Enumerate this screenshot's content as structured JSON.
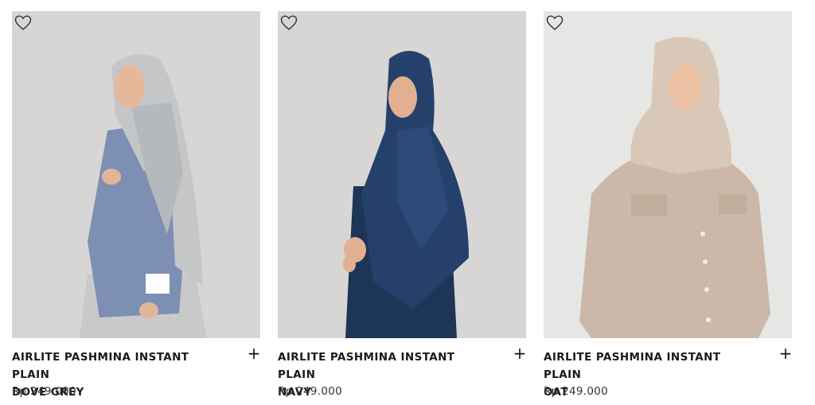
{
  "products": [
    {
      "title_line1": "AIRLITE PASHMINA INSTANT PLAIN",
      "title_line2": "DOVE GREY",
      "price": "Rp 249.000",
      "image_alt": "Model wearing Airlite Pashmina Instant Plain Dove Grey",
      "favorite_icon": "heart-outline-icon",
      "add_icon": "plus-icon",
      "add_symbol": "+",
      "colors": {
        "bg": "#d7d6d4",
        "scarf": "#c4c6c8",
        "garment": "#7d90b3"
      }
    },
    {
      "title_line1": "AIRLITE PASHMINA INSTANT PLAIN",
      "title_line2": "NAVY",
      "price": "Rp 249.000",
      "image_alt": "Model wearing Airlite Pashmina Instant Plain Navy",
      "favorite_icon": "heart-outline-icon",
      "add_icon": "plus-icon",
      "add_symbol": "+",
      "colors": {
        "bg": "#d7d6d4",
        "scarf": "#25406b",
        "garment": "#1d3556"
      }
    },
    {
      "title_line1": "AIRLITE PASHMINA INSTANT PLAIN",
      "title_line2": "OAT",
      "price": "Rp 249.000",
      "image_alt": "Model wearing Airlite Pashmina Instant Plain Oat",
      "favorite_icon": "heart-outline-icon",
      "add_icon": "plus-icon",
      "add_symbol": "+",
      "colors": {
        "bg": "#e6e6e4",
        "scarf": "#d9c8b8",
        "garment": "#cbb8a8"
      }
    }
  ]
}
